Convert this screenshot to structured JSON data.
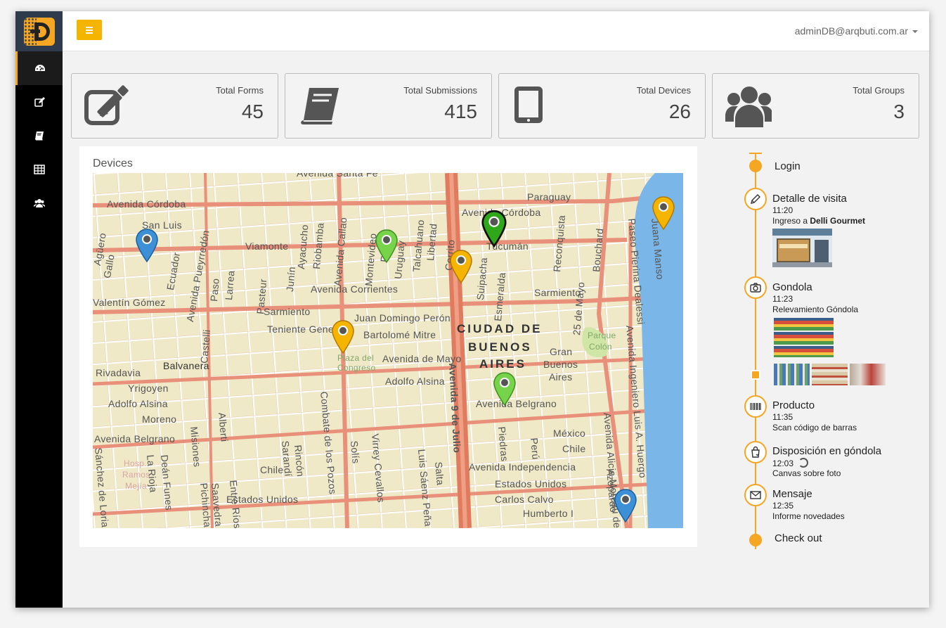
{
  "user": {
    "email": "adminDB@arqbuti.com.ar"
  },
  "sidebar": {
    "items": [
      {
        "icon": "dashboard-icon",
        "active": true
      },
      {
        "icon": "edit-icon",
        "active": false
      },
      {
        "icon": "book-icon",
        "active": false
      },
      {
        "icon": "table-icon",
        "active": false
      },
      {
        "icon": "users-icon",
        "active": false
      }
    ]
  },
  "stats": [
    {
      "label": "Total Forms",
      "value": "45",
      "icon": "edit-icon"
    },
    {
      "label": "Total Submissions",
      "value": "415",
      "icon": "book-icon"
    },
    {
      "label": "Total Devices",
      "value": "26",
      "icon": "tablet-icon"
    },
    {
      "label": "Total Groups",
      "value": "3",
      "icon": "users-icon"
    }
  ],
  "devices": {
    "title": "Devices",
    "streets": [
      "Avenida Santa Fe",
      "Avenida Córdoba",
      "Avenida Córdoba",
      "Paraguay",
      "San Luis",
      "Viamonte",
      "Tucumán",
      "Avenida Corrientes",
      "Sarmiento",
      "Valentín Gómez",
      "Sarmiento",
      "Teniente General",
      "Juan Domingo Perón",
      "Bartolomé Mitre",
      "Avenida de Mayo",
      "Balvanera",
      "Rivadavia",
      "Yrigoyen",
      "Adolfo Alsina",
      "Adolfo Alsina",
      "Moreno",
      "Avenida Belgrano",
      "Avenida Belgrano",
      "Chile",
      "Estados Unidos",
      "Avenida Independencia",
      "Estados Unidos",
      "Carlos Calvo",
      "Humberto I",
      "México",
      "Chile",
      "Gran",
      "Buenos",
      "Aires",
      "Plaza del",
      "Congreso",
      "Parque",
      "Colón",
      "Hosp.",
      "Ramos",
      "Mejía",
      "Agüero",
      "Gallo",
      "Ecuador",
      "Avenida Pueyrredón",
      "Larrea",
      "Paso",
      "Pasteur",
      "Junín",
      "Ayacucho",
      "Riobamba",
      "Avenida Callao",
      "Montevideo",
      "Uruguay",
      "Paraná",
      "Talcahuano",
      "Libertad",
      "Cerrito",
      "Suipacha",
      "Esmeralda",
      "Reconquista",
      "25 de Mayo",
      "Bouchard",
      "Avenida Alicia Moreau de Justo",
      "Avenida Ingeniero Luis A. Huergo",
      "Paseo Pierina Dealessi",
      "Juana Manso",
      "Avenida 9 de Julio",
      "Castelli",
      "Misiones",
      "Alberti",
      "Saavedra",
      "Sarandí",
      "Rincón",
      "Combate de los Pozos",
      "Solís",
      "Virrey Cevallos",
      "Luis Sáenz Peña",
      "Salta",
      "Piedras",
      "Perú",
      "Azopardo",
      "Sánchez de Loria",
      "La Rioja",
      "Deán Funes",
      "Pichincha",
      "Entre Ríos"
    ],
    "city_label": [
      "CIUDAD DE",
      "BUENOS",
      "AIRES"
    ],
    "pins": [
      {
        "color": "#3d8fd6"
      },
      {
        "color": "#77d44a"
      },
      {
        "color": "#f5b400"
      },
      {
        "color": "#2ea81a"
      },
      {
        "color": "#f5b400"
      },
      {
        "color": "#f5b400"
      },
      {
        "color": "#77d44a"
      },
      {
        "color": "#3d8fd6"
      }
    ]
  },
  "timeline": {
    "start": "Login",
    "end": "Check out",
    "events": [
      {
        "title": "Detalle de visita",
        "time": "11:20",
        "desc_prefix": "Ingreso a ",
        "desc_bold": "Delli Gourmet",
        "icon": "pencil-icon"
      },
      {
        "title": "Gondola",
        "time": "11:23",
        "desc": "Relevamiento Góndola",
        "icon": "camera-icon"
      },
      {
        "title": "Producto",
        "time": "11:35",
        "desc": "Scan código de barras",
        "icon": "barcode-icon"
      },
      {
        "title": "Disposición en góndola",
        "time": "12:03",
        "desc": "Canvas sobre foto",
        "icon": "shopping-bag-icon"
      },
      {
        "title": "Mensaje",
        "time": "12:35",
        "desc": "Informe novedades",
        "icon": "envelope-icon"
      }
    ]
  }
}
